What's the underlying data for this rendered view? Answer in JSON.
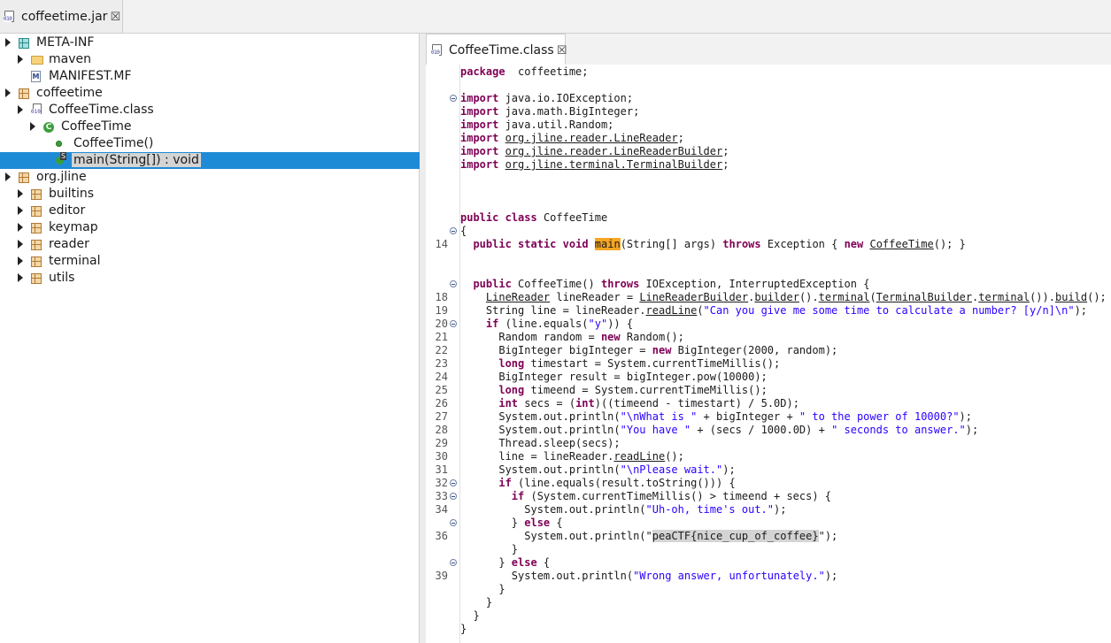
{
  "left_tab": {
    "title": "coffeetime.jar",
    "close": "☒"
  },
  "tree": [
    {
      "label": "META-INF",
      "indent": 0,
      "icon": "package-teal",
      "arrow": "right"
    },
    {
      "label": "maven",
      "indent": 1,
      "icon": "folder",
      "arrow": "right"
    },
    {
      "label": "MANIFEST.MF",
      "indent": 1,
      "icon": "manifest",
      "arrow": "none"
    },
    {
      "label": "coffeetime",
      "indent": 0,
      "icon": "package",
      "arrow": "right"
    },
    {
      "label": "CoffeeTime.class",
      "indent": 1,
      "icon": "classfile",
      "arrow": "right"
    },
    {
      "label": "CoffeeTime",
      "indent": 2,
      "icon": "class",
      "arrow": "right"
    },
    {
      "label": "CoffeeTime()",
      "indent": 3,
      "icon": "constructor",
      "arrow": "none"
    },
    {
      "label": "main(String[]) : void",
      "indent": 3,
      "icon": "method",
      "arrow": "none",
      "selected": true
    },
    {
      "label": "org.jline",
      "indent": 0,
      "icon": "package",
      "arrow": "right"
    },
    {
      "label": "builtins",
      "indent": 1,
      "icon": "package",
      "arrow": "right"
    },
    {
      "label": "editor",
      "indent": 1,
      "icon": "package",
      "arrow": "right"
    },
    {
      "label": "keymap",
      "indent": 1,
      "icon": "package",
      "arrow": "right"
    },
    {
      "label": "reader",
      "indent": 1,
      "icon": "package",
      "arrow": "right"
    },
    {
      "label": "terminal",
      "indent": 1,
      "icon": "package",
      "arrow": "right"
    },
    {
      "label": "utils",
      "indent": 1,
      "icon": "package",
      "arrow": "right"
    }
  ],
  "editor_tab": {
    "title": "CoffeeTime.class",
    "close": "☒"
  },
  "code": [
    {
      "ln": "",
      "fold": false,
      "segs": [
        [
          "kw",
          "package"
        ],
        [
          "",
          "  coffeetime;"
        ]
      ]
    },
    {
      "ln": "",
      "fold": false,
      "segs": []
    },
    {
      "ln": "",
      "fold": true,
      "segs": [
        [
          "kw",
          "import"
        ],
        [
          "",
          " java.io.IOException;"
        ]
      ]
    },
    {
      "ln": "",
      "fold": false,
      "segs": [
        [
          "kw",
          "import"
        ],
        [
          "",
          " java.math.BigInteger;"
        ]
      ]
    },
    {
      "ln": "",
      "fold": false,
      "segs": [
        [
          "kw",
          "import"
        ],
        [
          "",
          " java.util.Random;"
        ]
      ]
    },
    {
      "ln": "",
      "fold": false,
      "segs": [
        [
          "kw",
          "import"
        ],
        [
          "",
          " "
        ],
        [
          "ul",
          "org.jline.reader.LineReader"
        ],
        [
          "",
          ";"
        ]
      ]
    },
    {
      "ln": "",
      "fold": false,
      "segs": [
        [
          "kw",
          "import"
        ],
        [
          "",
          " "
        ],
        [
          "ul",
          "org.jline.reader.LineReaderBuilder"
        ],
        [
          "",
          ";"
        ]
      ]
    },
    {
      "ln": "",
      "fold": false,
      "segs": [
        [
          "kw",
          "import"
        ],
        [
          "",
          " "
        ],
        [
          "ul",
          "org.jline.terminal.TerminalBuilder"
        ],
        [
          "",
          ";"
        ]
      ]
    },
    {
      "ln": "",
      "fold": false,
      "segs": []
    },
    {
      "ln": "",
      "fold": false,
      "segs": []
    },
    {
      "ln": "",
      "fold": false,
      "segs": []
    },
    {
      "ln": "",
      "fold": false,
      "segs": [
        [
          "kw",
          "public"
        ],
        [
          "",
          " "
        ],
        [
          "kw",
          "class"
        ],
        [
          "",
          " CoffeeTime"
        ]
      ]
    },
    {
      "ln": "",
      "fold": true,
      "segs": [
        [
          "",
          "{"
        ]
      ]
    },
    {
      "ln": "14",
      "fold": false,
      "segs": [
        [
          "",
          "  "
        ],
        [
          "kw",
          "public"
        ],
        [
          "",
          " "
        ],
        [
          "kw",
          "static"
        ],
        [
          "",
          " "
        ],
        [
          "kw",
          "void"
        ],
        [
          "",
          " "
        ],
        [
          "hl",
          "main"
        ],
        [
          "",
          "(String[] args) "
        ],
        [
          "kw",
          "throws"
        ],
        [
          "",
          " Exception { "
        ],
        [
          "kw",
          "new"
        ],
        [
          "",
          " "
        ],
        [
          "ul",
          "CoffeeTime"
        ],
        [
          "",
          "(); }"
        ]
      ]
    },
    {
      "ln": "",
      "fold": false,
      "segs": []
    },
    {
      "ln": "",
      "fold": false,
      "segs": []
    },
    {
      "ln": "",
      "fold": true,
      "segs": [
        [
          "",
          "  "
        ],
        [
          "kw",
          "public"
        ],
        [
          "",
          " CoffeeTime() "
        ],
        [
          "kw",
          "throws"
        ],
        [
          "",
          " IOException, InterruptedException {"
        ]
      ]
    },
    {
      "ln": "18",
      "fold": false,
      "segs": [
        [
          "",
          "    "
        ],
        [
          "ul",
          "LineReader"
        ],
        [
          "",
          " lineReader = "
        ],
        [
          "ul",
          "LineReaderBuilder"
        ],
        [
          "",
          "."
        ],
        [
          "ul",
          "builder"
        ],
        [
          "",
          "()."
        ],
        [
          "ul",
          "terminal"
        ],
        [
          "",
          "("
        ],
        [
          "ul",
          "TerminalBuilder"
        ],
        [
          "",
          "."
        ],
        [
          "ul",
          "terminal"
        ],
        [
          "",
          "())."
        ],
        [
          "ul",
          "build"
        ],
        [
          "",
          "();"
        ]
      ]
    },
    {
      "ln": "19",
      "fold": false,
      "segs": [
        [
          "",
          "    String line = lineReader."
        ],
        [
          "ul",
          "readLine"
        ],
        [
          "",
          "("
        ],
        [
          "str",
          "\"Can you give me some time to calculate a number? [y/n]\\n\""
        ],
        [
          "",
          ");"
        ]
      ]
    },
    {
      "ln": "20",
      "fold": true,
      "segs": [
        [
          "",
          "    "
        ],
        [
          "kw",
          "if"
        ],
        [
          "",
          " (line.equals("
        ],
        [
          "str",
          "\"y\""
        ],
        [
          "",
          ")) {"
        ]
      ]
    },
    {
      "ln": "21",
      "fold": false,
      "segs": [
        [
          "",
          "      Random random = "
        ],
        [
          "kw",
          "new"
        ],
        [
          "",
          " Random();"
        ]
      ]
    },
    {
      "ln": "22",
      "fold": false,
      "segs": [
        [
          "",
          "      BigInteger bigInteger = "
        ],
        [
          "kw",
          "new"
        ],
        [
          "",
          " BigInteger(2000, random);"
        ]
      ]
    },
    {
      "ln": "23",
      "fold": false,
      "segs": [
        [
          "",
          "      "
        ],
        [
          "kw",
          "long"
        ],
        [
          "",
          " timestart = System.currentTimeMillis();"
        ]
      ]
    },
    {
      "ln": "24",
      "fold": false,
      "segs": [
        [
          "",
          "      BigInteger result = bigInteger.pow(10000);"
        ]
      ]
    },
    {
      "ln": "25",
      "fold": false,
      "segs": [
        [
          "",
          "      "
        ],
        [
          "kw",
          "long"
        ],
        [
          "",
          " timeend = System.currentTimeMillis();"
        ]
      ]
    },
    {
      "ln": "26",
      "fold": false,
      "segs": [
        [
          "",
          "      "
        ],
        [
          "kw",
          "int"
        ],
        [
          "",
          " secs = ("
        ],
        [
          "kw",
          "int"
        ],
        [
          "",
          ")((timeend - timestart) / 5.0D);"
        ]
      ]
    },
    {
      "ln": "27",
      "fold": false,
      "segs": [
        [
          "",
          "      System.out.println("
        ],
        [
          "str",
          "\"\\nWhat is \""
        ],
        [
          "",
          " + bigInteger + "
        ],
        [
          "str",
          "\" to the power of 10000?\""
        ],
        [
          "",
          ");"
        ]
      ]
    },
    {
      "ln": "28",
      "fold": false,
      "segs": [
        [
          "",
          "      System.out.println("
        ],
        [
          "str",
          "\"You have \""
        ],
        [
          "",
          " + (secs / 1000.0D) + "
        ],
        [
          "str",
          "\" seconds to answer.\""
        ],
        [
          "",
          ");"
        ]
      ]
    },
    {
      "ln": "29",
      "fold": false,
      "segs": [
        [
          "",
          "      Thread.sleep(secs);"
        ]
      ]
    },
    {
      "ln": "30",
      "fold": false,
      "segs": [
        [
          "",
          "      line = lineReader."
        ],
        [
          "ul",
          "readLine"
        ],
        [
          "",
          "();"
        ]
      ]
    },
    {
      "ln": "31",
      "fold": false,
      "segs": [
        [
          "",
          "      System.out.println("
        ],
        [
          "str",
          "\"\\nPlease wait.\""
        ],
        [
          "",
          ");"
        ]
      ]
    },
    {
      "ln": "32",
      "fold": true,
      "segs": [
        [
          "",
          "      "
        ],
        [
          "kw",
          "if"
        ],
        [
          "",
          " (line.equals(result.toString())) {"
        ]
      ]
    },
    {
      "ln": "33",
      "fold": true,
      "segs": [
        [
          "",
          "        "
        ],
        [
          "kw",
          "if"
        ],
        [
          "",
          " (System.currentTimeMillis() > timeend + secs) {"
        ]
      ]
    },
    {
      "ln": "34",
      "fold": false,
      "segs": [
        [
          "",
          "          System.out.println("
        ],
        [
          "str",
          "\"Uh-oh, time's out.\""
        ],
        [
          "",
          ");"
        ]
      ]
    },
    {
      "ln": "",
      "fold": true,
      "segs": [
        [
          "",
          "        } "
        ],
        [
          "kw",
          "else"
        ],
        [
          "",
          " {"
        ]
      ]
    },
    {
      "ln": "36",
      "fold": false,
      "segs": [
        [
          "",
          "          System.out.println(\""
        ],
        [
          "gray",
          "peaCTF{nice_cup_of_coffee}"
        ],
        [
          "",
          "\");"
        ]
      ]
    },
    {
      "ln": "",
      "fold": false,
      "segs": [
        [
          "",
          "        }"
        ]
      ]
    },
    {
      "ln": "",
      "fold": true,
      "segs": [
        [
          "",
          "      } "
        ],
        [
          "kw",
          "else"
        ],
        [
          "",
          " {"
        ]
      ]
    },
    {
      "ln": "39",
      "fold": false,
      "segs": [
        [
          "",
          "        System.out.println("
        ],
        [
          "str",
          "\"Wrong answer, unfortunately.\""
        ],
        [
          "",
          ");"
        ]
      ]
    },
    {
      "ln": "",
      "fold": false,
      "segs": [
        [
          "",
          "      }"
        ]
      ]
    },
    {
      "ln": "",
      "fold": false,
      "segs": [
        [
          "",
          "    }"
        ]
      ]
    },
    {
      "ln": "",
      "fold": false,
      "segs": [
        [
          "",
          "  }"
        ]
      ]
    },
    {
      "ln": "",
      "fold": false,
      "segs": [
        [
          "",
          "}"
        ]
      ]
    }
  ]
}
